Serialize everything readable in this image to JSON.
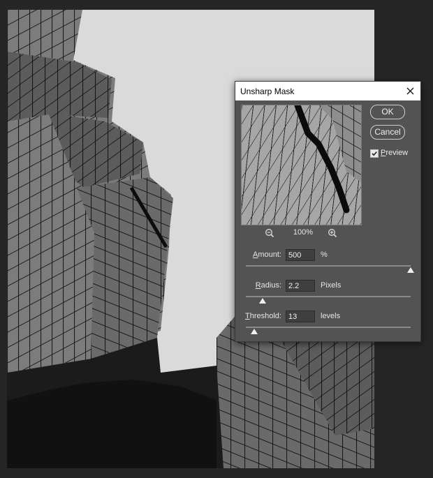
{
  "dialog": {
    "title": "Unsharp Mask",
    "ok_label": "OK",
    "cancel_label": "Cancel",
    "preview_label_first": "P",
    "preview_label_rest": "review",
    "preview_checked": true,
    "zoom_level": "100%"
  },
  "params": {
    "amount": {
      "label_first": "A",
      "label_rest": "mount:",
      "value": "500",
      "unit": "%",
      "slider_fraction": 1.0
    },
    "radius": {
      "label_first": "R",
      "label_rest": "adius:",
      "value": "2.2",
      "unit": "Pixels",
      "slider_fraction": 0.1
    },
    "threshold": {
      "label_first": "T",
      "label_rest": "hreshold:",
      "value": "13",
      "unit": "levels",
      "slider_fraction": 0.05
    }
  }
}
